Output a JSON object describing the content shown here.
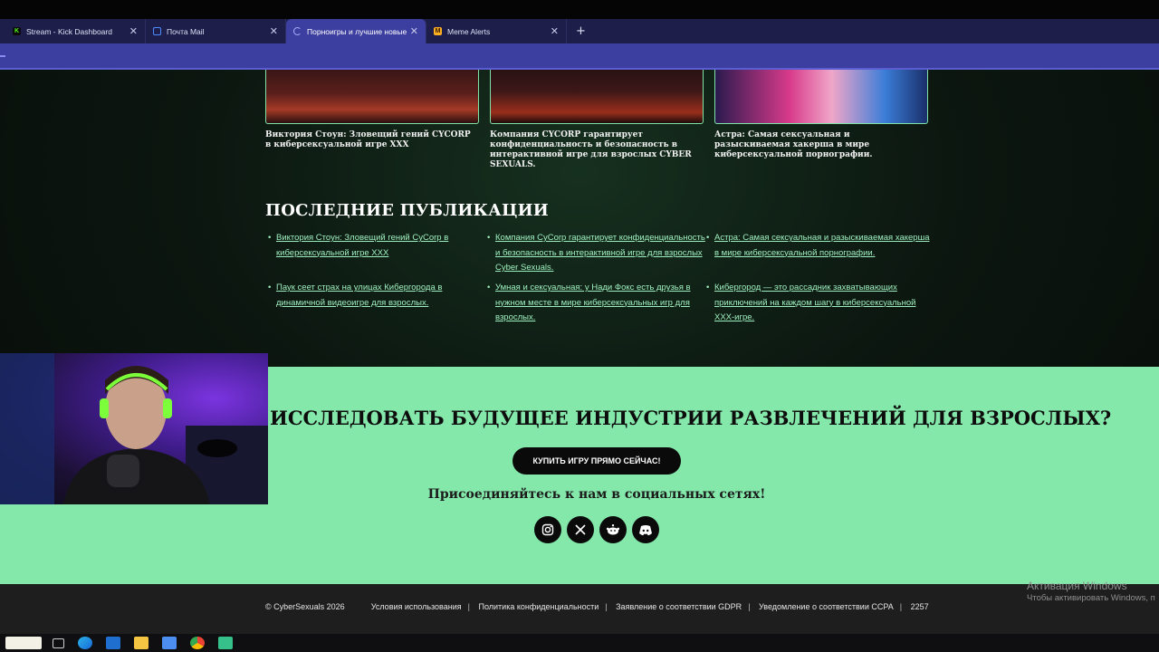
{
  "browser": {
    "tabs": [
      {
        "title": "Stream - Kick Dashboard",
        "active": false,
        "color": "#53fc18"
      },
      {
        "title": "Почта Mail",
        "active": false,
        "color": "#4a8cff"
      },
      {
        "title": "Порноигры и лучшие новые",
        "active": true,
        "color": "#7b7fe8"
      },
      {
        "title": "Meme Alerts",
        "active": false,
        "color": "#ffb020"
      }
    ],
    "new_tab": "+"
  },
  "featured": [
    {
      "caption": "Виктория Стоун: Зловещий гений CYCORP в киберсексуальной игре XXX"
    },
    {
      "caption": "Компания CYCORP гарантирует конфиденциальность и безопасность в интерактивной игре для взрослых CYBER SEXUALS."
    },
    {
      "caption": "Астра: Самая сексуальная и разыскиваемая хакерша в мире киберсексуальной порнографии."
    }
  ],
  "latest": {
    "heading": "ПОСЛЕДНИЕ ПУБЛИКАЦИИ",
    "items": [
      "Виктория Стоун: Зловещий гений CyCorp в киберсексуальной игре XXX",
      "Компания CyCorp гарантирует конфиденциальность и безопасность в интерактивной игре для взрослых Cyber Sexuals.",
      "Астра: Самая сексуальная и разыскиваемая хакерша в мире киберсексуальной порнографии.",
      "Паук сеет страх на улицах Кибергорода в динамичной видеоигре для взрослых.",
      "Умная и сексуальная: у Нади Фокс есть друзья в нужном месте в мире киберсексуальных игр для взрослых.",
      "Кибергород — это рассадник захватывающих приключений на каждом шагу в киберсексуальной XXX-игре."
    ]
  },
  "cta": {
    "title": "ИССЛЕДОВАТЬ БУДУЩЕЕ ИНДУСТРИИ РАЗВЛЕЧЕНИЙ ДЛЯ ВЗРОСЛЫХ?",
    "button": "КУПИТЬ ИГРУ ПРЯМО СЕЙЧАС!",
    "social_heading": "Присоединяйтесь к нам в социальных сетях!",
    "social_icons": [
      "instagram-icon",
      "x-icon",
      "reddit-icon",
      "discord-icon"
    ],
    "background": "#84e8ab"
  },
  "footer": {
    "copyright": "© CyberSexuals 2026",
    "links": [
      "Условия использования",
      "Политика конфиденциальности",
      "Заявление о соответствии GDPR",
      "Уведомление о соответствии CCPA"
    ],
    "counter": "2257"
  },
  "windows_activation": {
    "line1": "Активация Windows",
    "line2": "Чтобы активировать Windows, п"
  }
}
